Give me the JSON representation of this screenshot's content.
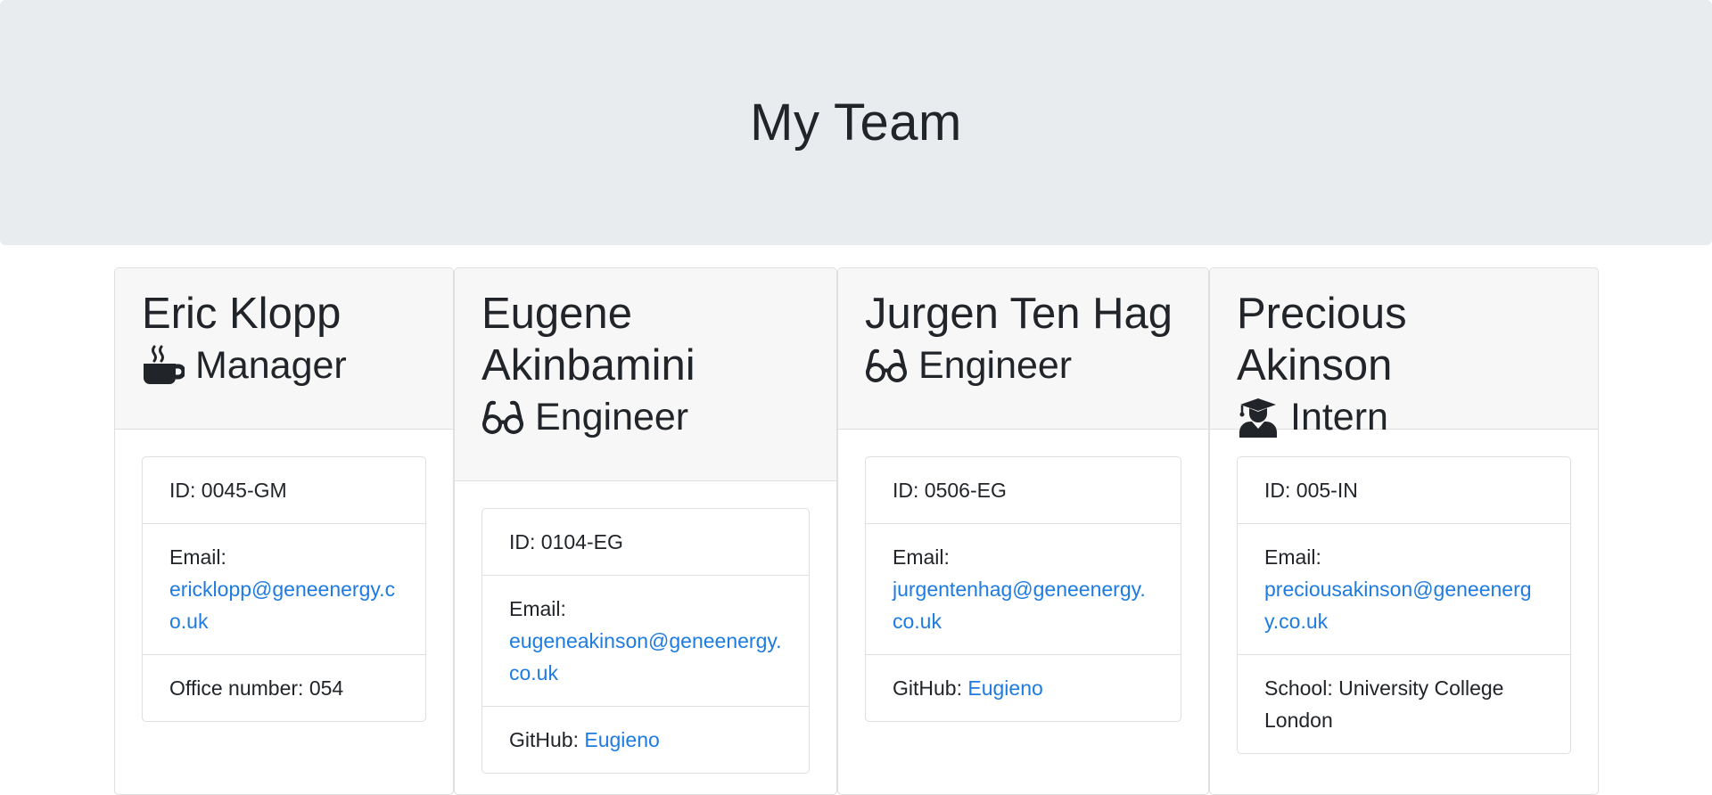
{
  "header": {
    "title": "My Team"
  },
  "team": [
    {
      "name": "Eric Klopp",
      "role": "Manager",
      "role_icon": "mug-icon",
      "id_label": "ID: ",
      "id": "0045-GM",
      "email_label": "Email:",
      "email": "ericklopp@geneenergy.co.uk",
      "extra_label": "Office number: ",
      "extra_value": "054"
    },
    {
      "name": "Eugene Akinbamini",
      "role": "Engineer",
      "role_icon": "glasses-icon",
      "id_label": "ID: ",
      "id": "0104-EG",
      "email_label": "Email:",
      "email": "eugeneakinson@geneenergy.co.uk",
      "extra_label": "GitHub: ",
      "extra_value": "Eugieno"
    },
    {
      "name": "Jurgen Ten Hag",
      "role": "Engineer",
      "role_icon": "glasses-icon",
      "id_label": "ID: ",
      "id": "0506-EG",
      "email_label": "Email:",
      "email": "jurgentenhag@geneenergy.co.uk",
      "extra_label": "GitHub: ",
      "extra_value": "Eugieno"
    },
    {
      "name": "Precious Akinson",
      "role": "Intern",
      "role_icon": "graduate-icon",
      "id_label": "ID: ",
      "id": "005-IN",
      "email_label": "Email:",
      "email": "preciousakinson@geneenergy.co.uk",
      "extra_label": "School: ",
      "extra_value": "University College London"
    }
  ],
  "colors": {
    "link": "#1e7be0",
    "header_bg": "#e9ecef",
    "card_header_bg": "#f7f7f7"
  }
}
